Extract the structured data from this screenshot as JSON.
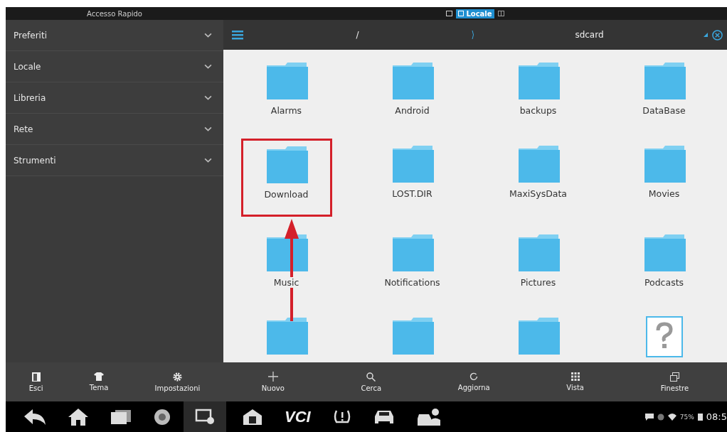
{
  "sidebar": {
    "title": "Accesso Rapido",
    "items": [
      {
        "label": "Preferiti",
        "expanded": false
      },
      {
        "label": "Locale",
        "expanded": false
      },
      {
        "label": "Libreria",
        "expanded": false
      },
      {
        "label": "Rete",
        "expanded": false
      },
      {
        "label": "Strumenti",
        "expanded": false
      }
    ],
    "toolbar": [
      {
        "label": "Esci"
      },
      {
        "label": "Tema"
      },
      {
        "label": "Impostazioni"
      }
    ]
  },
  "window": {
    "tabs": [
      {
        "label": "Locale",
        "selected": true
      }
    ]
  },
  "path": {
    "segments": [
      "/",
      "sdcard"
    ]
  },
  "files": [
    {
      "name": "Alarms",
      "kind": "folder",
      "highlighted": false
    },
    {
      "name": "Android",
      "kind": "folder",
      "highlighted": false
    },
    {
      "name": "backups",
      "kind": "folder",
      "highlighted": false
    },
    {
      "name": "DataBase",
      "kind": "folder",
      "highlighted": false
    },
    {
      "name": "Download",
      "kind": "folder",
      "highlighted": true
    },
    {
      "name": "LOST.DIR",
      "kind": "folder",
      "highlighted": false
    },
    {
      "name": "MaxiSysData",
      "kind": "folder",
      "highlighted": false
    },
    {
      "name": "Movies",
      "kind": "folder",
      "highlighted": false
    },
    {
      "name": "Music",
      "kind": "folder",
      "highlighted": false
    },
    {
      "name": "Notifications",
      "kind": "folder",
      "highlighted": false
    },
    {
      "name": "Pictures",
      "kind": "folder",
      "highlighted": false
    },
    {
      "name": "Podcasts",
      "kind": "folder",
      "highlighted": false
    },
    {
      "kind": "folder",
      "highlighted": false
    },
    {
      "kind": "folder",
      "highlighted": false
    },
    {
      "kind": "folder",
      "highlighted": false
    },
    {
      "kind": "unknown",
      "highlighted": false
    }
  ],
  "toolbar": [
    {
      "label": "Nuovo"
    },
    {
      "label": "Cerca"
    },
    {
      "label": "Aggiorna"
    },
    {
      "label": "Vista"
    },
    {
      "label": "Finestre"
    }
  ],
  "navbar": {
    "vci": "VCI",
    "battery": "75%",
    "time": "08:5"
  }
}
